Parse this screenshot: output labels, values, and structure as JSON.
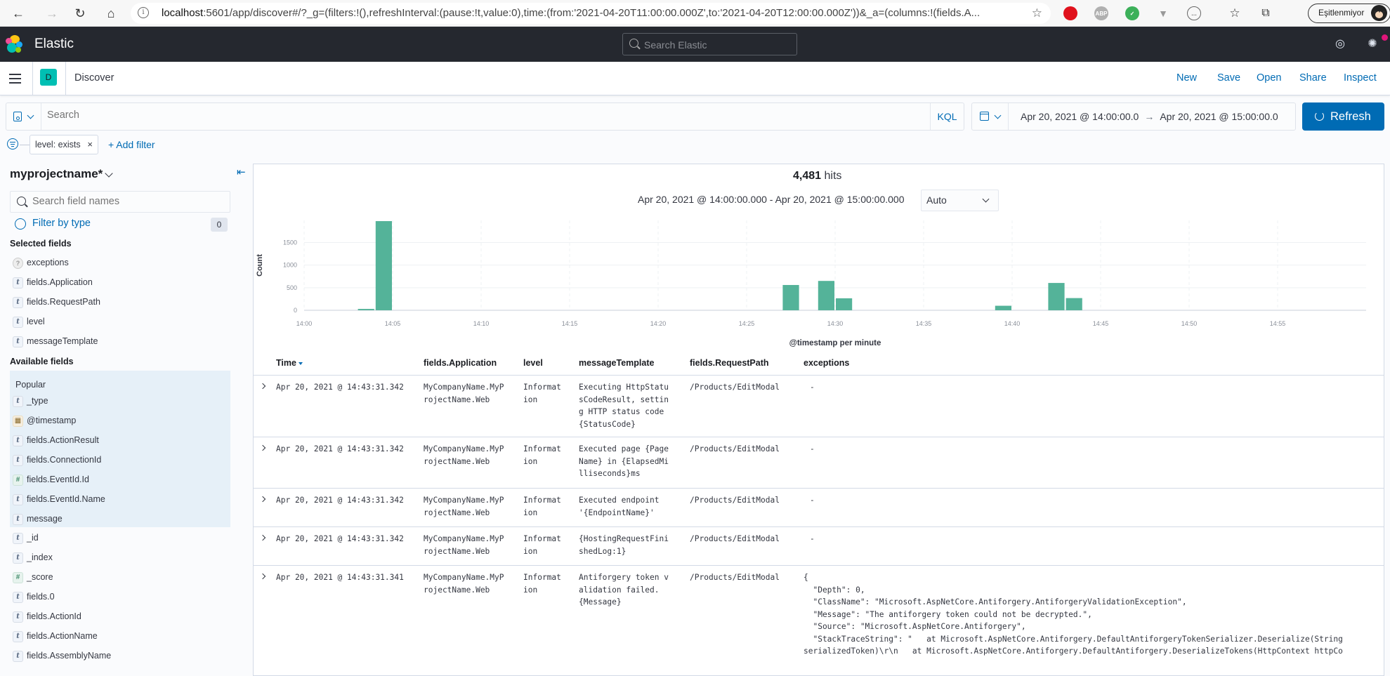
{
  "browser": {
    "url_host": "localhost",
    "url_rest": ":5601/app/discover#/?_g=(filters:!(),refreshInterval:(pause:!t,value:0),time:(from:'2021-04-20T11:00:00.000Z',to:'2021-04-20T12:00:00.000Z'))&_a=(columns:!(fields.A...",
    "profile_label": "Eşitlenmiyor",
    "extensions": [
      "opera-icon",
      "abp-icon",
      "shield-check-icon",
      "vue-icon",
      "code-icon"
    ],
    "ext_labels": {
      "abp": "ABP"
    }
  },
  "header": {
    "app_name": "Elastic",
    "search_placeholder": "Search Elastic"
  },
  "breadcrumb": {
    "space_initial": "D",
    "current": "Discover"
  },
  "top_nav": [
    "New",
    "Save",
    "Open",
    "Share",
    "Inspect"
  ],
  "query": {
    "placeholder": "Search",
    "language": "KQL",
    "date_from": "Apr 20, 2021 @ 14:00:00.0",
    "date_arrow": "→",
    "date_to": "Apr 20, 2021 @ 15:00:00.0",
    "refresh_label": "Refresh"
  },
  "filters": {
    "pills": [
      {
        "label": "level: exists",
        "close": "×"
      }
    ],
    "add_label": "+ Add filter"
  },
  "sidebar": {
    "index_pattern": "myprojectname*",
    "search_placeholder": "Search field names",
    "filter_by_type": "Filter by type",
    "filter_count": "0",
    "selected_title": "Selected fields",
    "selected_fields": [
      {
        "name": "exceptions",
        "type": "unknown",
        "token": "?"
      },
      {
        "name": "fields.Application",
        "type": "string",
        "token": "t"
      },
      {
        "name": "fields.RequestPath",
        "type": "string",
        "token": "t"
      },
      {
        "name": "level",
        "type": "string",
        "token": "t"
      },
      {
        "name": "messageTemplate",
        "type": "string",
        "token": "t"
      }
    ],
    "available_title": "Available fields",
    "popular_label": "Popular",
    "popular_fields": [
      {
        "name": "_type",
        "type": "string",
        "token": "t"
      },
      {
        "name": "@timestamp",
        "type": "date",
        "token": "▦"
      },
      {
        "name": "fields.ActionResult",
        "type": "string",
        "token": "t"
      },
      {
        "name": "fields.ConnectionId",
        "type": "string",
        "token": "t"
      },
      {
        "name": "fields.EventId.Id",
        "type": "number",
        "token": "#"
      },
      {
        "name": "fields.EventId.Name",
        "type": "string",
        "token": "t"
      },
      {
        "name": "message",
        "type": "string",
        "token": "t"
      }
    ],
    "other_fields": [
      {
        "name": "_id",
        "type": "string",
        "token": "t"
      },
      {
        "name": "_index",
        "type": "string",
        "token": "t"
      },
      {
        "name": "_score",
        "type": "number",
        "token": "#"
      },
      {
        "name": "fields.0",
        "type": "string",
        "token": "t"
      },
      {
        "name": "fields.ActionId",
        "type": "string",
        "token": "t"
      },
      {
        "name": "fields.ActionName",
        "type": "string",
        "token": "t"
      },
      {
        "name": "fields.AssemblyName",
        "type": "string",
        "token": "t"
      }
    ]
  },
  "results": {
    "hits_count": "4,481",
    "hits_label": "hits",
    "time_range": "Apr 20, 2021 @ 14:00:00.000 - Apr 20, 2021 @ 15:00:00.000",
    "interval": "Auto"
  },
  "chart_data": {
    "type": "bar",
    "title": "",
    "xlabel": "@timestamp per minute",
    "ylabel": "Count",
    "x_ticks": [
      "14:00",
      "14:05",
      "14:10",
      "14:15",
      "14:20",
      "14:25",
      "14:30",
      "14:35",
      "14:40",
      "14:45",
      "14:50",
      "14:55"
    ],
    "y_ticks": [
      0,
      500,
      1000,
      1500
    ],
    "ylim": [
      0,
      1990
    ],
    "xlim_minutes": [
      0,
      60
    ],
    "grid": true,
    "color": "#54b399",
    "bars": [
      {
        "minute": 3,
        "label": "14:03",
        "value": 30
      },
      {
        "minute": 4,
        "label": "14:04",
        "value": 1975
      },
      {
        "minute": 27,
        "label": "14:27",
        "value": 560
      },
      {
        "minute": 29,
        "label": "14:29",
        "value": 650
      },
      {
        "minute": 30,
        "label": "14:30",
        "value": 265
      },
      {
        "minute": 39,
        "label": "14:39",
        "value": 100
      },
      {
        "minute": 42,
        "label": "14:42",
        "value": 605
      },
      {
        "minute": 43,
        "label": "14:43",
        "value": 270
      }
    ]
  },
  "table": {
    "columns": [
      "Time",
      "fields.Application",
      "level",
      "messageTemplate",
      "fields.RequestPath",
      "exceptions"
    ],
    "rows": [
      {
        "time": "Apr 20, 2021 @ 14:43:31.342",
        "application": "MyCompanyName.MyP\nrojectName.Web",
        "level": "Informat\nion",
        "message_template": "Executing HttpStatu\nsCodeResult, settin\ng HTTP status code\n{StatusCode}",
        "request_path": "/Products/EditModal",
        "exceptions": "-"
      },
      {
        "time": "Apr 20, 2021 @ 14:43:31.342",
        "application": "MyCompanyName.MyP\nrojectName.Web",
        "level": "Informat\nion",
        "message_template": "Executed page {Page\nName} in {ElapsedMi\nlliseconds}ms",
        "request_path": "/Products/EditModal",
        "exceptions": "-"
      },
      {
        "time": "Apr 20, 2021 @ 14:43:31.342",
        "application": "MyCompanyName.MyP\nrojectName.Web",
        "level": "Informat\nion",
        "message_template": "Executed endpoint\n'{EndpointName}'",
        "request_path": "/Products/EditModal",
        "exceptions": "-"
      },
      {
        "time": "Apr 20, 2021 @ 14:43:31.342",
        "application": "MyCompanyName.MyP\nrojectName.Web",
        "level": "Informat\nion",
        "message_template": "{HostingRequestFini\nshedLog:1}",
        "request_path": "/Products/EditModal",
        "exceptions": "-"
      },
      {
        "time": "Apr 20, 2021 @ 14:43:31.341",
        "application": "MyCompanyName.MyP\nrojectName.Web",
        "level": "Informat\nion",
        "message_template": "Antiforgery token v\nalidation failed.\n{Message}",
        "request_path": "/Products/EditModal",
        "exceptions": "{\n  \"Depth\": 0,\n  \"ClassName\": \"Microsoft.AspNetCore.Antiforgery.AntiforgeryValidationException\",\n  \"Message\": \"The antiforgery token could not be decrypted.\",\n  \"Source\": \"Microsoft.AspNetCore.Antiforgery\",\n  \"StackTraceString\": \"   at Microsoft.AspNetCore.Antiforgery.DefaultAntiforgeryTokenSerializer.Deserialize(String\nserializedToken)\\r\\n   at Microsoft.AspNetCore.Antiforgery.DefaultAntiforgery.DeserializeTokens(HttpContext httpCo"
      }
    ]
  }
}
